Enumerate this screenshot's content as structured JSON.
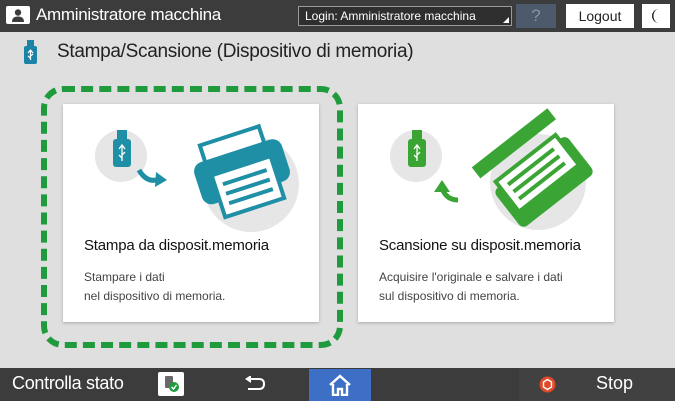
{
  "header": {
    "user_name": "Amministratore macchina",
    "login_field_value": "Login: Amministratore macchina",
    "help_label": "?",
    "logout_label": "Logout"
  },
  "page": {
    "title": "Stampa/Scansione (Dispositivo di memoria)",
    "icon": "usb-stick-icon"
  },
  "cards": [
    {
      "title": "Stampa da disposit.memoria",
      "desc_line1": "Stampare i dati",
      "desc_line2": "nel dispositivo di memoria.",
      "accent": "#1f8fa6",
      "icon": "printer-from-usb-icon",
      "selected": true
    },
    {
      "title": "Scansione su disposit.memoria",
      "desc_line1": "Acquisire l'originale e salvare i dati",
      "desc_line2": "sul dispositivo di memoria.",
      "accent": "#3aa535",
      "icon": "scanner-to-usb-icon",
      "selected": false
    }
  ],
  "footer": {
    "status_label": "Controlla stato",
    "stop_label": "Stop"
  },
  "colors": {
    "bar_bg": "#3c3c3c",
    "home_blue": "#3d6fc6",
    "selection_green": "#1f9a3c",
    "stop_red": "#e04a2a"
  }
}
